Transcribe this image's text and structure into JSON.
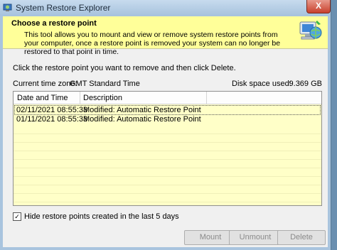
{
  "window": {
    "title": "System Restore Explorer",
    "close_glyph": "X"
  },
  "header": {
    "title": "Choose a restore point",
    "description": "This tool allows you to mount and view or remove system restore points from your computer, once a restore point is removed your system can no longer be restored to that point in time."
  },
  "instructions": "Click the restore point you want to remove and then click Delete.",
  "timezone": {
    "label": "Current time zone:",
    "value": "GMT Standard Time"
  },
  "disk": {
    "label": "Disk space used:",
    "value": "9.369 GB"
  },
  "table": {
    "columns": [
      "Date and Time",
      "Description"
    ],
    "rows": [
      {
        "date": "02/11/2021 08:55:33",
        "description": "Modified: Automatic Restore Point"
      },
      {
        "date": "01/11/2021 08:55:33",
        "description": "Modified: Automatic Restore Point"
      }
    ]
  },
  "hide_recent": {
    "label": "Hide restore points created in the last 5 days",
    "checked": true
  },
  "buttons": {
    "mount": "Mount",
    "unmount": "Unmount",
    "delete": "Delete"
  },
  "icons": {
    "app": "restore-app-icon",
    "header": "computer-globe-icon"
  },
  "colors": {
    "header_bg": "#ffff99",
    "list_bg": "#ffffc8",
    "title_bar": "#a9c4de",
    "close": "#c8402c"
  }
}
